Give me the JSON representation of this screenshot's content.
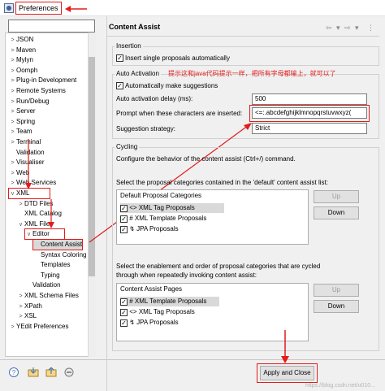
{
  "window": {
    "title": "Preferences"
  },
  "tree": {
    "items": [
      {
        "label": "JSON",
        "indent": 0,
        "twisty": ">"
      },
      {
        "label": "Maven",
        "indent": 0,
        "twisty": ">"
      },
      {
        "label": "Mylyn",
        "indent": 0,
        "twisty": ">"
      },
      {
        "label": "Oomph",
        "indent": 0,
        "twisty": ">"
      },
      {
        "label": "Plug-in Development",
        "indent": 0,
        "twisty": ">"
      },
      {
        "label": "Remote Systems",
        "indent": 0,
        "twisty": ">"
      },
      {
        "label": "Run/Debug",
        "indent": 0,
        "twisty": ">"
      },
      {
        "label": "Server",
        "indent": 0,
        "twisty": ">"
      },
      {
        "label": "Spring",
        "indent": 0,
        "twisty": ">"
      },
      {
        "label": "Team",
        "indent": 0,
        "twisty": ">"
      },
      {
        "label": "Terminal",
        "indent": 0,
        "twisty": ">"
      },
      {
        "label": "Validation",
        "indent": 0,
        "twisty": ""
      },
      {
        "label": "Visualiser",
        "indent": 0,
        "twisty": ">"
      },
      {
        "label": "Web",
        "indent": 0,
        "twisty": ">"
      },
      {
        "label": "Web Services",
        "indent": 0,
        "twisty": ">"
      },
      {
        "label": "XML",
        "indent": 0,
        "twisty": "v"
      },
      {
        "label": "DTD Files",
        "indent": 1,
        "twisty": ">"
      },
      {
        "label": "XML Catalog",
        "indent": 1,
        "twisty": ""
      },
      {
        "label": "XML Files",
        "indent": 1,
        "twisty": "v"
      },
      {
        "label": "Editor",
        "indent": 2,
        "twisty": "v"
      },
      {
        "label": "Content Assist",
        "indent": 3,
        "twisty": ""
      },
      {
        "label": "Syntax Coloring",
        "indent": 3,
        "twisty": ""
      },
      {
        "label": "Templates",
        "indent": 3,
        "twisty": ""
      },
      {
        "label": "Typing",
        "indent": 3,
        "twisty": ""
      },
      {
        "label": "Validation",
        "indent": 2,
        "twisty": ""
      },
      {
        "label": "XML Schema Files",
        "indent": 1,
        "twisty": ">"
      },
      {
        "label": "XPath",
        "indent": 1,
        "twisty": ">"
      },
      {
        "label": "XSL",
        "indent": 1,
        "twisty": ">"
      },
      {
        "label": "YEdit Preferences",
        "indent": 0,
        "twisty": ">"
      }
    ]
  },
  "page": {
    "title": "Content Assist",
    "nav_back": "⇦",
    "nav_back_menu": "▾",
    "nav_fwd": "⇨",
    "nav_fwd_menu": "▾",
    "menu": "⋮"
  },
  "insertion": {
    "label": "Insertion",
    "single_proposals": "Insert single proposals automatically"
  },
  "auto": {
    "label": "Auto Activation",
    "annotation": "提示这和java代码提示一样，把所有字母都输上，就可以了",
    "make_suggestions": "Automatically make suggestions",
    "delay_label": "Auto activation delay (ms):",
    "delay_value": "500",
    "prompt_label": "Prompt when these characters are inserted:",
    "prompt_value": "<=:.abcdefghijklmnopqrstuvwxyz(",
    "strategy_label": "Suggestion strategy:",
    "strategy_value": "Strict"
  },
  "cycling": {
    "label": "Cycling",
    "desc": "Configure the behavior of the content assist (Ctrl+/) command.",
    "default_desc": "Select the proposal categories contained in the 'default' content assist list:",
    "default_header": "Default Proposal Categories",
    "default_items": [
      {
        "icon": "<>",
        "label": "XML Tag Proposals"
      },
      {
        "icon": "#",
        "label": "XML Template Proposals"
      },
      {
        "icon": "↯",
        "label": "JPA Proposals"
      }
    ],
    "up": "Up",
    "down": "Down",
    "cycle_desc_1": "Select the enablement and order of proposal categories that are cycled",
    "cycle_desc_2": "through when repeatedly invoking content assist:",
    "pages_header": "Content Assist Pages",
    "pages_items": [
      {
        "icon": "#",
        "label": "XML Template Proposals"
      },
      {
        "icon": "<>",
        "label": "XML Tag Proposals"
      },
      {
        "icon": "↯",
        "label": "JPA Proposals"
      }
    ]
  },
  "footer": {
    "apply_close": "Apply and Close",
    "watermark": "https://blog.csdn.net/u010..."
  },
  "colors": {
    "annotation": "#e31b1b",
    "accent": "#0078d7"
  }
}
